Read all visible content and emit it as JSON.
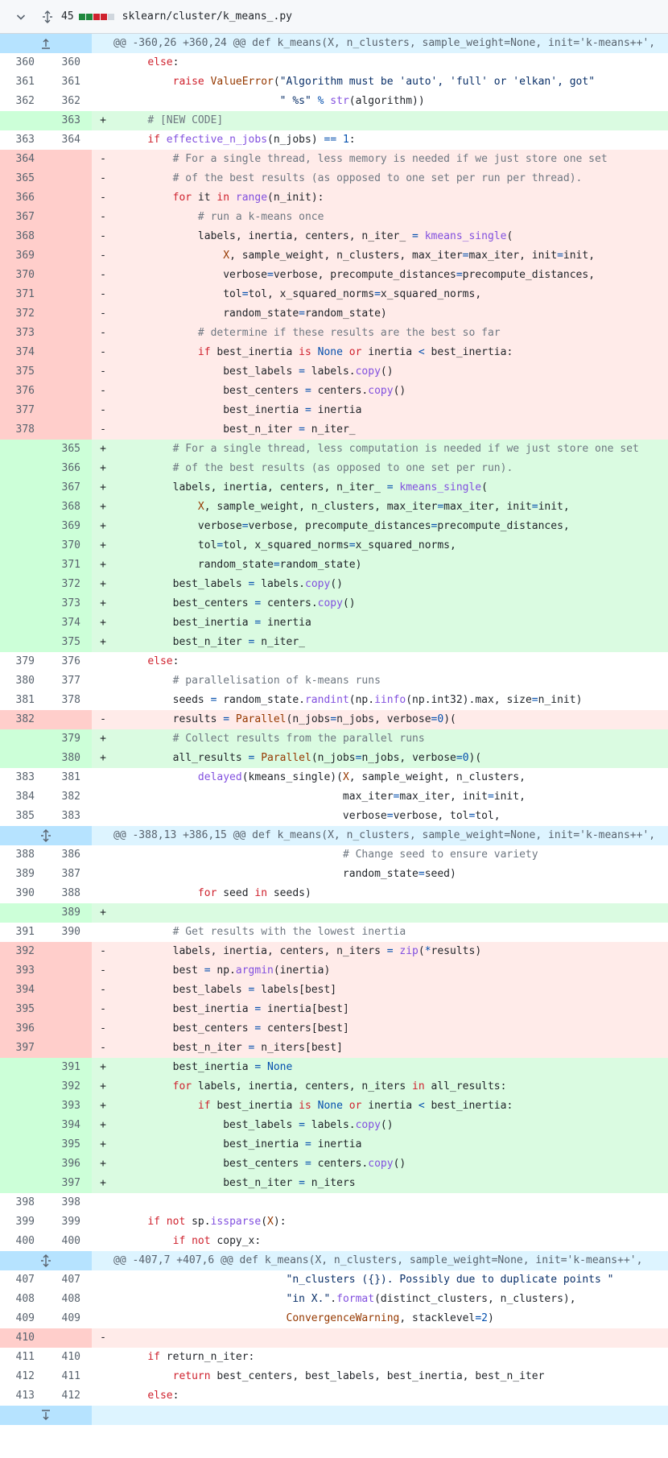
{
  "file_header": {
    "changes_count": "45",
    "file_path": "sklearn/cluster/k_means_.py",
    "diffstat_colors": [
      "#1f883d",
      "#1f883d",
      "#cf222e",
      "#cf222e",
      "#d0d7de"
    ]
  },
  "colors": {
    "add_bg": "#dafbe1",
    "add_num_bg": "#ccffd8",
    "del_bg": "#ffebe9",
    "del_num_bg": "#ffcecb",
    "hunk_bg": "#ddf4ff",
    "hunk_gutter_bg": "#b6e3ff"
  },
  "diff_rows": [
    {
      "type": "hunk",
      "text": "@@ -360,26 +360,24 @@ def k_means(X, n_clusters, sample_weight=None, init='k-means++',",
      "icon": "expand-up-icon"
    },
    {
      "type": "ctx",
      "old": "360",
      "new": "360",
      "sign": "",
      "code": "    else:"
    },
    {
      "type": "ctx",
      "old": "361",
      "new": "361",
      "sign": "",
      "code": "        raise ValueError(\"Algorithm must be 'auto', 'full' or 'elkan', got\""
    },
    {
      "type": "ctx",
      "old": "362",
      "new": "362",
      "sign": "",
      "code": "                         \" %s\" % str(algorithm))"
    },
    {
      "type": "add",
      "old": "",
      "new": "363",
      "sign": "+",
      "code": "    # [NEW CODE]"
    },
    {
      "type": "ctx",
      "old": "363",
      "new": "364",
      "sign": "",
      "code": "    if effective_n_jobs(n_jobs) == 1:"
    },
    {
      "type": "del",
      "old": "364",
      "new": "",
      "sign": "-",
      "code": "        # For a single thread, less memory is needed if we just store one set"
    },
    {
      "type": "del",
      "old": "365",
      "new": "",
      "sign": "-",
      "code": "        # of the best results (as opposed to one set per run per thread)."
    },
    {
      "type": "del",
      "old": "366",
      "new": "",
      "sign": "-",
      "code": "        for it in range(n_init):"
    },
    {
      "type": "del",
      "old": "367",
      "new": "",
      "sign": "-",
      "code": "            # run a k-means once"
    },
    {
      "type": "del",
      "old": "368",
      "new": "",
      "sign": "-",
      "code": "            labels, inertia, centers, n_iter_ = kmeans_single("
    },
    {
      "type": "del",
      "old": "369",
      "new": "",
      "sign": "-",
      "code": "                X, sample_weight, n_clusters, max_iter=max_iter, init=init,"
    },
    {
      "type": "del",
      "old": "370",
      "new": "",
      "sign": "-",
      "code": "                verbose=verbose, precompute_distances=precompute_distances,"
    },
    {
      "type": "del",
      "old": "371",
      "new": "",
      "sign": "-",
      "code": "                tol=tol, x_squared_norms=x_squared_norms,"
    },
    {
      "type": "del",
      "old": "372",
      "new": "",
      "sign": "-",
      "code": "                random_state=random_state)"
    },
    {
      "type": "del",
      "old": "373",
      "new": "",
      "sign": "-",
      "code": "            # determine if these results are the best so far"
    },
    {
      "type": "del",
      "old": "374",
      "new": "",
      "sign": "-",
      "code": "            if best_inertia is None or inertia < best_inertia:"
    },
    {
      "type": "del",
      "old": "375",
      "new": "",
      "sign": "-",
      "code": "                best_labels = labels.copy()"
    },
    {
      "type": "del",
      "old": "376",
      "new": "",
      "sign": "-",
      "code": "                best_centers = centers.copy()"
    },
    {
      "type": "del",
      "old": "377",
      "new": "",
      "sign": "-",
      "code": "                best_inertia = inertia"
    },
    {
      "type": "del",
      "old": "378",
      "new": "",
      "sign": "-",
      "code": "                best_n_iter = n_iter_"
    },
    {
      "type": "add",
      "old": "",
      "new": "365",
      "sign": "+",
      "code": "        # For a single thread, less computation is needed if we just store one set"
    },
    {
      "type": "add",
      "old": "",
      "new": "366",
      "sign": "+",
      "code": "        # of the best results (as opposed to one set per run)."
    },
    {
      "type": "add",
      "old": "",
      "new": "367",
      "sign": "+",
      "code": "        labels, inertia, centers, n_iter_ = kmeans_single("
    },
    {
      "type": "add",
      "old": "",
      "new": "368",
      "sign": "+",
      "code": "            X, sample_weight, n_clusters, max_iter=max_iter, init=init,"
    },
    {
      "type": "add",
      "old": "",
      "new": "369",
      "sign": "+",
      "code": "            verbose=verbose, precompute_distances=precompute_distances,"
    },
    {
      "type": "add",
      "old": "",
      "new": "370",
      "sign": "+",
      "code": "            tol=tol, x_squared_norms=x_squared_norms,"
    },
    {
      "type": "add",
      "old": "",
      "new": "371",
      "sign": "+",
      "code": "            random_state=random_state)"
    },
    {
      "type": "add",
      "old": "",
      "new": "372",
      "sign": "+",
      "code": "        best_labels = labels.copy()"
    },
    {
      "type": "add",
      "old": "",
      "new": "373",
      "sign": "+",
      "code": "        best_centers = centers.copy()"
    },
    {
      "type": "add",
      "old": "",
      "new": "374",
      "sign": "+",
      "code": "        best_inertia = inertia"
    },
    {
      "type": "add",
      "old": "",
      "new": "375",
      "sign": "+",
      "code": "        best_n_iter = n_iter_"
    },
    {
      "type": "ctx",
      "old": "379",
      "new": "376",
      "sign": "",
      "code": "    else:"
    },
    {
      "type": "ctx",
      "old": "380",
      "new": "377",
      "sign": "",
      "code": "        # parallelisation of k-means runs"
    },
    {
      "type": "ctx",
      "old": "381",
      "new": "378",
      "sign": "",
      "code": "        seeds = random_state.randint(np.iinfo(np.int32).max, size=n_init)"
    },
    {
      "type": "del",
      "old": "382",
      "new": "",
      "sign": "-",
      "code": "        results = Parallel(n_jobs=n_jobs, verbose=0)("
    },
    {
      "type": "add",
      "old": "",
      "new": "379",
      "sign": "+",
      "code": "        # Collect results from the parallel runs"
    },
    {
      "type": "add",
      "old": "",
      "new": "380",
      "sign": "+",
      "code": "        all_results = Parallel(n_jobs=n_jobs, verbose=0)("
    },
    {
      "type": "ctx",
      "old": "383",
      "new": "381",
      "sign": "",
      "code": "            delayed(kmeans_single)(X, sample_weight, n_clusters,"
    },
    {
      "type": "ctx",
      "old": "384",
      "new": "382",
      "sign": "",
      "code": "                                   max_iter=max_iter, init=init,"
    },
    {
      "type": "ctx",
      "old": "385",
      "new": "383",
      "sign": "",
      "code": "                                   verbose=verbose, tol=tol,"
    },
    {
      "type": "hunk",
      "text": "@@ -388,13 +386,15 @@ def k_means(X, n_clusters, sample_weight=None, init='k-means++',",
      "icon": "expand-both-icon"
    },
    {
      "type": "ctx",
      "old": "388",
      "new": "386",
      "sign": "",
      "code": "                                   # Change seed to ensure variety"
    },
    {
      "type": "ctx",
      "old": "389",
      "new": "387",
      "sign": "",
      "code": "                                   random_state=seed)"
    },
    {
      "type": "ctx",
      "old": "390",
      "new": "388",
      "sign": "",
      "code": "            for seed in seeds)"
    },
    {
      "type": "add",
      "old": "",
      "new": "389",
      "sign": "+",
      "code": ""
    },
    {
      "type": "ctx",
      "old": "391",
      "new": "390",
      "sign": "",
      "code": "        # Get results with the lowest inertia"
    },
    {
      "type": "del",
      "old": "392",
      "new": "",
      "sign": "-",
      "code": "        labels, inertia, centers, n_iters = zip(*results)"
    },
    {
      "type": "del",
      "old": "393",
      "new": "",
      "sign": "-",
      "code": "        best = np.argmin(inertia)"
    },
    {
      "type": "del",
      "old": "394",
      "new": "",
      "sign": "-",
      "code": "        best_labels = labels[best]"
    },
    {
      "type": "del",
      "old": "395",
      "new": "",
      "sign": "-",
      "code": "        best_inertia = inertia[best]"
    },
    {
      "type": "del",
      "old": "396",
      "new": "",
      "sign": "-",
      "code": "        best_centers = centers[best]"
    },
    {
      "type": "del",
      "old": "397",
      "new": "",
      "sign": "-",
      "code": "        best_n_iter = n_iters[best]"
    },
    {
      "type": "add",
      "old": "",
      "new": "391",
      "sign": "+",
      "code": "        best_inertia = None"
    },
    {
      "type": "add",
      "old": "",
      "new": "392",
      "sign": "+",
      "code": "        for labels, inertia, centers, n_iters in all_results:"
    },
    {
      "type": "add",
      "old": "",
      "new": "393",
      "sign": "+",
      "code": "            if best_inertia is None or inertia < best_inertia:"
    },
    {
      "type": "add",
      "old": "",
      "new": "394",
      "sign": "+",
      "code": "                best_labels = labels.copy()"
    },
    {
      "type": "add",
      "old": "",
      "new": "395",
      "sign": "+",
      "code": "                best_inertia = inertia"
    },
    {
      "type": "add",
      "old": "",
      "new": "396",
      "sign": "+",
      "code": "                best_centers = centers.copy()"
    },
    {
      "type": "add",
      "old": "",
      "new": "397",
      "sign": "+",
      "code": "                best_n_iter = n_iters"
    },
    {
      "type": "ctx",
      "old": "398",
      "new": "398",
      "sign": "",
      "code": ""
    },
    {
      "type": "ctx",
      "old": "399",
      "new": "399",
      "sign": "",
      "code": "    if not sp.issparse(X):"
    },
    {
      "type": "ctx",
      "old": "400",
      "new": "400",
      "sign": "",
      "code": "        if not copy_x:"
    },
    {
      "type": "hunk",
      "text": "@@ -407,7 +407,6 @@ def k_means(X, n_clusters, sample_weight=None, init='k-means++',",
      "icon": "expand-both-icon"
    },
    {
      "type": "ctx",
      "old": "407",
      "new": "407",
      "sign": "",
      "code": "                          \"n_clusters ({}). Possibly due to duplicate points \""
    },
    {
      "type": "ctx",
      "old": "408",
      "new": "408",
      "sign": "",
      "code": "                          \"in X.\".format(distinct_clusters, n_clusters),"
    },
    {
      "type": "ctx",
      "old": "409",
      "new": "409",
      "sign": "",
      "code": "                          ConvergenceWarning, stacklevel=2)"
    },
    {
      "type": "del",
      "old": "410",
      "new": "",
      "sign": "-",
      "code": ""
    },
    {
      "type": "ctx",
      "old": "411",
      "new": "410",
      "sign": "",
      "code": "    if return_n_iter:"
    },
    {
      "type": "ctx",
      "old": "412",
      "new": "411",
      "sign": "",
      "code": "        return best_centers, best_labels, best_inertia, best_n_iter"
    },
    {
      "type": "ctx",
      "old": "413",
      "new": "412",
      "sign": "",
      "code": "    else:"
    },
    {
      "type": "hunk",
      "text": "",
      "icon": "expand-down-icon"
    }
  ]
}
